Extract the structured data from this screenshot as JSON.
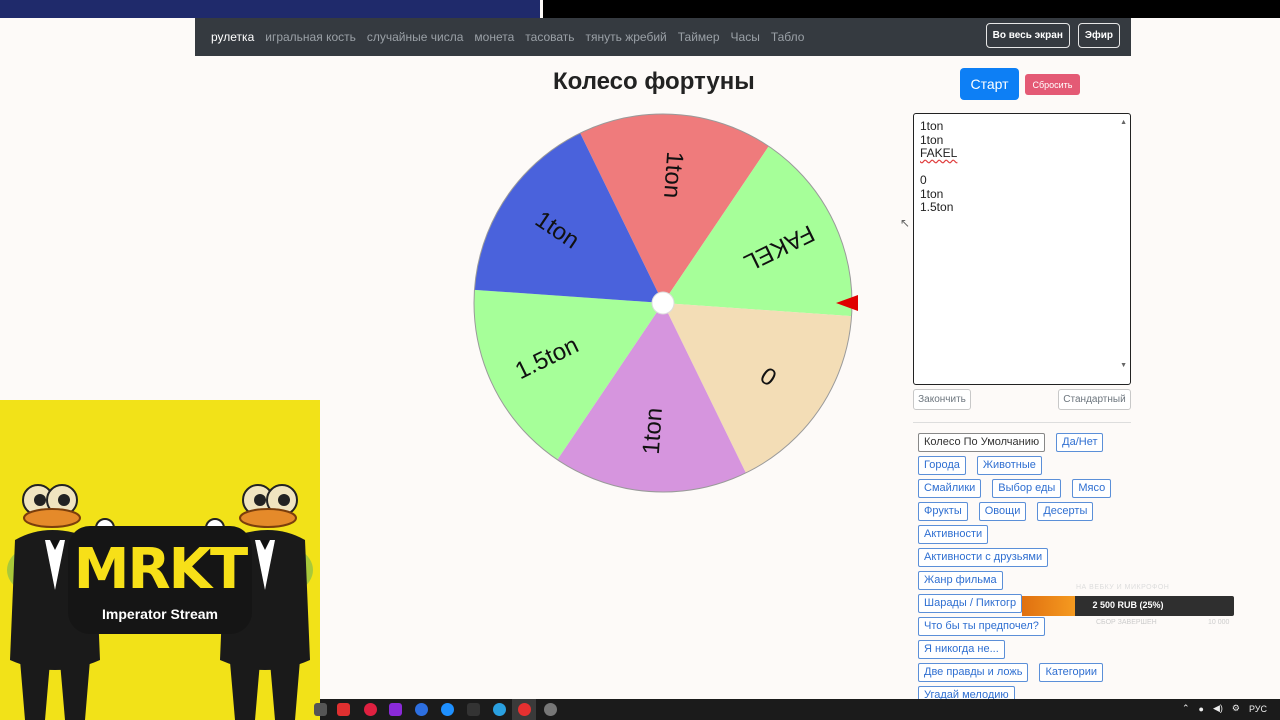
{
  "nav": {
    "items": [
      "рулетка",
      "игральная кость",
      "случайные числа",
      "монета",
      "тасовать",
      "тянуть жребий",
      "Таймер",
      "Часы",
      "Табло"
    ],
    "active_index": 0,
    "fullscreen_label": "Во весь экран",
    "broadcast_label": "Эфир"
  },
  "page": {
    "title": "Колесо фортуны"
  },
  "controls": {
    "start_label": "Старт",
    "reset_label": "Сбросить"
  },
  "wheel": {
    "segments": [
      {
        "label": "1ton",
        "color": "#ef7b7c"
      },
      {
        "label": "FAKEL",
        "color": "#a6ff99"
      },
      {
        "label": "0",
        "color": "#f3ddb6"
      },
      {
        "label": "1ton",
        "color": "#d695de"
      },
      {
        "label": "1.5ton",
        "color": "#a6ff99"
      },
      {
        "label": "1ton",
        "color": "#4a62dc"
      }
    ],
    "pointer_color": "#e00000"
  },
  "entries": {
    "lines": [
      "1ton",
      "1ton",
      "FAKEL",
      "",
      "0",
      "1ton",
      "1.5ton"
    ],
    "finish_label": "Закончить",
    "standard_label": "Стандартный"
  },
  "presets": [
    [
      "Колесо По Умолчанию",
      "Да/Нет"
    ],
    [
      "Города",
      "Животные"
    ],
    [
      "Смайлики",
      "Выбор еды",
      "Мясо"
    ],
    [
      "Фрукты",
      "Овощи",
      "Десерты"
    ],
    [
      "Активности"
    ],
    [
      "Активности с друзьями"
    ],
    [
      "Жанр фильма"
    ],
    [
      "Шарады / Пиктогр"
    ],
    [
      "Что бы ты предпочел?"
    ],
    [
      "Я никогда не..."
    ],
    [
      "Две правды и ложь",
      "Категории"
    ],
    [
      "Угадай мелодию"
    ]
  ],
  "donation": {
    "title": "НА ВЕБКУ И МИКРОФОН",
    "amount_text": "2 500 RUB (25%)",
    "progress": 0.25,
    "sub_text": "СБОР ЗАВЕРШЕН",
    "max_text": "10 000"
  },
  "stream": {
    "logo_text": "MRKT",
    "logo_sub": "Imperator Stream"
  },
  "taskbar": {
    "lang": "РУС"
  }
}
